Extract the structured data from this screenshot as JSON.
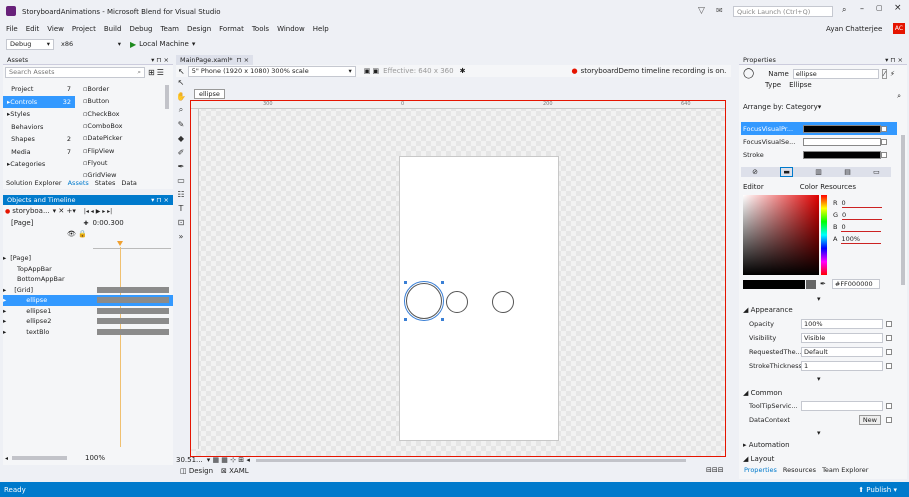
{
  "window": {
    "title": "StoryboardAnimations - Microsoft Blend for Visual Studio",
    "quick_launch_placeholder": "Quick Launch (Ctrl+Q)",
    "user": "Ayan Chatterjee",
    "user_initials": "AC"
  },
  "menu": [
    "File",
    "Edit",
    "View",
    "Project",
    "Build",
    "Debug",
    "Team",
    "Design",
    "Format",
    "Tools",
    "Window",
    "Help"
  ],
  "toolbar": {
    "config": "Debug",
    "platform": "x86",
    "run_target": "Local Machine"
  },
  "assets": {
    "title": "Assets",
    "search_placeholder": "Search Assets",
    "categories": [
      {
        "label": "Project",
        "count": "7"
      },
      {
        "label": "Controls",
        "count": "32"
      },
      {
        "label": "Styles",
        "count": ""
      },
      {
        "label": "Behaviors",
        "count": ""
      },
      {
        "label": "Shapes",
        "count": "2"
      },
      {
        "label": "Media",
        "count": "7"
      },
      {
        "label": "Categories",
        "count": ""
      }
    ],
    "items": [
      "Border",
      "Button",
      "CheckBox",
      "ComboBox",
      "DatePicker",
      "FlipView",
      "Flyout",
      "GridView"
    ],
    "tabs": [
      "Solution Explorer",
      "Assets",
      "States",
      "Data"
    ]
  },
  "objects": {
    "title": "Objects and Timeline",
    "storyboard": "storyboa...",
    "time": "0:00.300",
    "page_label": "[Page]",
    "tree": [
      "[Page]",
      "TopAppBar",
      "BottomAppBar",
      "[Grid]",
      "ellipse",
      "ellipse1",
      "ellipse2",
      "textBlo"
    ],
    "zoom": "100%"
  },
  "document": {
    "tab": "MainPage.xaml*",
    "device": "5\" Phone (1920 x 1080) 300% scale",
    "effective": "Effective: 640 x 360",
    "recording": "storyboardDemo timeline recording is on.",
    "breadcrumb": "ellipse",
    "ruler_marks": [
      "300",
      "0",
      "200",
      "640"
    ],
    "zoom": "30.51...",
    "bottom_tabs": [
      "Design",
      "XAML"
    ]
  },
  "properties": {
    "title": "Properties",
    "name_label": "Name",
    "name_value": "ellipse",
    "type_label": "Type",
    "type_value": "Ellipse",
    "arrange": "Arrange by: Category",
    "brushes": [
      "FocusVisualPr...",
      "FocusVisualSe...",
      "Stroke"
    ],
    "editor_label": "Editor",
    "color_resources": "Color Resources",
    "rgba": [
      {
        "k": "R",
        "v": "0"
      },
      {
        "k": "G",
        "v": "0"
      },
      {
        "k": "B",
        "v": "0"
      },
      {
        "k": "A",
        "v": "100%"
      }
    ],
    "hex": "#FF000000",
    "appearance_title": "Appearance",
    "appearance": [
      {
        "label": "Opacity",
        "value": "100%"
      },
      {
        "label": "Visibility",
        "value": "Visible"
      },
      {
        "label": "RequestedThe...",
        "value": "Default"
      },
      {
        "label": "StrokeThickness",
        "value": "1"
      }
    ],
    "common_title": "Common",
    "common": [
      {
        "label": "ToolTipServic...",
        "value": ""
      },
      {
        "label": "DataContext",
        "value": "New"
      }
    ],
    "automation": "Automation",
    "layout": "Layout",
    "tabs": [
      "Properties",
      "Resources",
      "Team Explorer"
    ]
  },
  "status": {
    "left": "Ready",
    "right": "Publish"
  },
  "colors": {
    "accent": "#007acc",
    "recording": "#e51400",
    "selection": "#3399ff"
  }
}
